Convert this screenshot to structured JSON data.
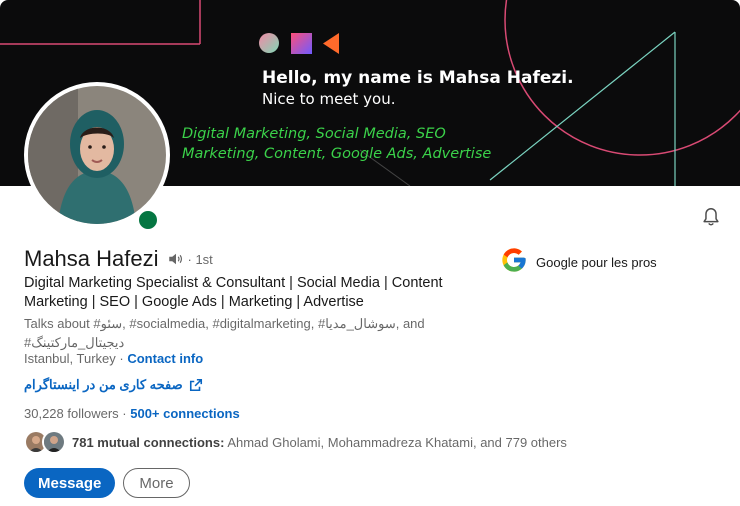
{
  "banner": {
    "line1": "Hello, my name is Mahsa Hafezi.",
    "line2": "Nice to meet you.",
    "tags_line1": "Digital Marketing, Social Media, SEO",
    "tags_line2": "Marketing, Content, Google Ads, Advertise"
  },
  "profile": {
    "name": "Mahsa Hafezi",
    "degree": "· 1st",
    "headline": "Digital Marketing Specialist & Consultant | Social Media | Content Marketing | SEO | Google Ads | Marketing | Advertise",
    "talks_about": "Talks about #سئو, #socialmedia, #digitalmarketing, #سوشال_مدیا, and #دیجیتال_مارکتینگ",
    "location": "Istanbul, Turkey",
    "location_sep": " · ",
    "contact_info": "Contact info",
    "website": "صفحه کاری من در اینستاگرام",
    "followers": "30,228 followers",
    "followers_sep": " · ",
    "connections": "500+ connections",
    "mutual_count": "781 mutual connections:",
    "mutual_names": " Ahmad Gholami, Mohammadreza Khatami, and 779 others"
  },
  "company": {
    "name": "Google pour les pros"
  },
  "actions": {
    "message": "Message",
    "more": "More"
  },
  "colors": {
    "link": "#0a66c2",
    "online": "#057642",
    "banner_bg": "#0b0b0c",
    "tag_green": "#3bd24a"
  },
  "icons": [
    "speaker-icon",
    "bell-icon",
    "external-link-icon",
    "google-logo"
  ]
}
